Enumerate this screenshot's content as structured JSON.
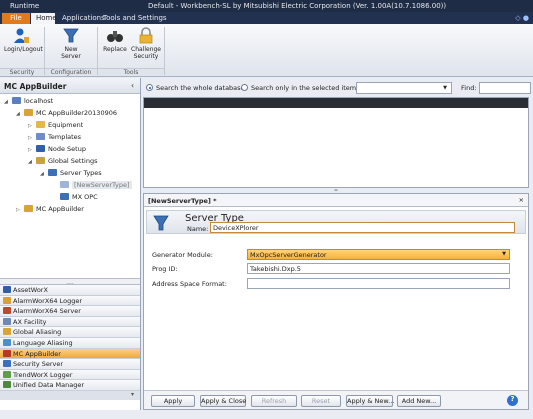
{
  "window": {
    "app_label": "Runtime",
    "title": "Default - Workbench-SL by Mitsubishi Electric Corporation  (Ver. 1.00A(10.7.1086.00))"
  },
  "tabs": [
    "File",
    "Home",
    "Applications",
    "Tools and Settings"
  ],
  "ribbon": {
    "buttons": {
      "login": "Login/Logout",
      "new_server": [
        "New",
        "Server"
      ],
      "replace": "Replace",
      "challenge": [
        "Challenge",
        "Security"
      ]
    },
    "groups": {
      "security": "Security",
      "configuration": "Configuration",
      "tools": "Tools"
    }
  },
  "left_panel": {
    "title": "MC AppBuilder",
    "collapse": "‹",
    "tree": {
      "localhost": "localhost",
      "mc_appbuilder_proj": "MC AppBuilder20130906",
      "equipment": "Equipment",
      "templates": "Templates",
      "node_setup": "Node Setup",
      "global_settings": "Global Settings",
      "server_types": "Server Types",
      "new_server_type": "[NewServerType]",
      "mx_opc": "MX OPC",
      "mc_appbuilder": "MC AppBuilder"
    },
    "splitter": "....",
    "nav": [
      "AssetWorX",
      "AlarmWorX64 Logger",
      "AlarmWorX64 Server",
      "AX Facility",
      "Global Aliasing",
      "Language Aliasing",
      "MC AppBuilder",
      "Security Server",
      "TrendWorX Logger",
      "Unified Data Manager"
    ],
    "nav_active": "MC AppBuilder",
    "nav_more": "▾"
  },
  "search": {
    "whole_db": "Search the whole database",
    "selected_only": "Search only in the selected item",
    "find_label": "Find:"
  },
  "editor": {
    "tab_label": "[NewServerType] *",
    "header_title": "Server Type",
    "name_label": "Name:",
    "name_value": "DeviceXPlorer",
    "fields": {
      "generator_label": "Generator Module:",
      "generator_value": "MxOpcServerGenerator",
      "progid_label": "Prog ID:",
      "progid_value": "Takebishi.Dxp.5",
      "address_label": "Address Space Format:",
      "address_value": ""
    },
    "buttons": {
      "apply": "Apply",
      "apply_close": "Apply & Close",
      "refresh": "Refresh",
      "reset": "Reset",
      "apply_new": "Apply & New...",
      "add_new": "Add New..."
    },
    "help": "?"
  },
  "colors": {
    "accent_orange": "#f4a73a",
    "titlebar": "#1f2c45",
    "file_tab": "#e07a1a"
  }
}
